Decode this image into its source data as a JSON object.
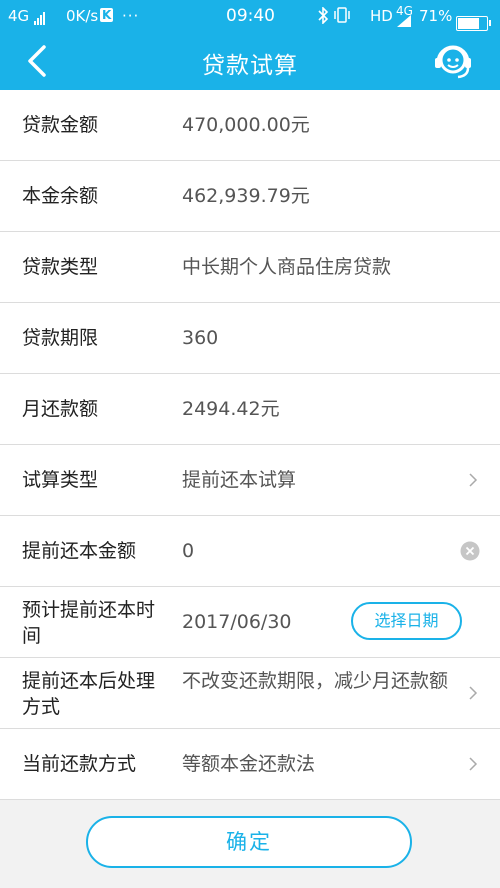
{
  "status_bar": {
    "network_left": "4G",
    "speed": "0K/s",
    "k_badge": "K",
    "dots": "···",
    "time": "09:40",
    "hd": "HD",
    "network_right": "4G",
    "battery": "71%",
    "battery_level": 0.71,
    "icons": [
      "signal-bars-icon",
      "k-app-icon",
      "bluetooth-icon",
      "vibrate-icon",
      "signal-icon",
      "battery-icon"
    ]
  },
  "nav": {
    "title": "贷款试算",
    "back_icon": "chevron-left-icon",
    "service_icon": "customer-service-icon"
  },
  "rows": [
    {
      "label": "贷款金额",
      "value": "470,000.00元"
    },
    {
      "label": "本金余额",
      "value": "462,939.79元"
    },
    {
      "label": "贷款类型",
      "value": "中长期个人商品住房贷款"
    },
    {
      "label": "贷款期限",
      "value": "360"
    },
    {
      "label": "月还款额",
      "value": "2494.42元"
    },
    {
      "label": "试算类型",
      "value": "提前还本试算"
    },
    {
      "label": "提前还本金额",
      "value": "0"
    },
    {
      "label": "预计提前还本时间",
      "value": "2017/06/30",
      "button": "选择日期"
    },
    {
      "label": "提前还本后处理方式",
      "value": "不改变还款期限，减少月还款额"
    },
    {
      "label": "当前还款方式",
      "value": "等额本金还款法"
    }
  ],
  "confirm_label": "确定",
  "colors": {
    "accent": "#1ab2e8",
    "background": "#f2f2f2",
    "row_bg": "#ffffff",
    "divider": "#dcdcdc"
  }
}
